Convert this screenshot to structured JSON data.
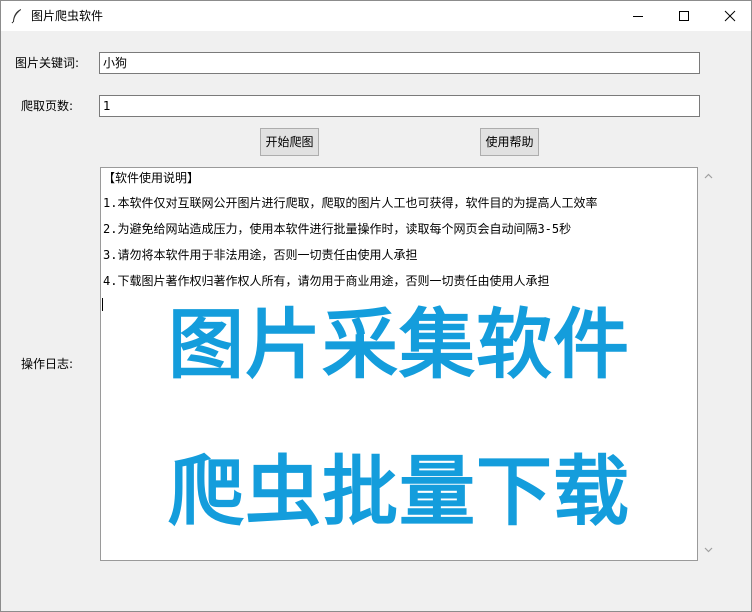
{
  "window": {
    "title": "图片爬虫软件"
  },
  "form": {
    "keyword_label": "图片关键词:",
    "keyword_value": "小狗",
    "pages_label": "爬取页数:",
    "pages_value": "1",
    "start_button": "开始爬图",
    "help_button": "使用帮助",
    "log_label": "操作日志:"
  },
  "log": {
    "lines": [
      "【软件使用说明】",
      "1.本软件仅对互联网公开图片进行爬取，爬取的图片人工也可获得，软件目的为提高人工效率",
      "2.为避免给网站造成压力，使用本软件进行批量操作时，读取每个网页会自动间隔3-5秒",
      "3.请勿将本软件用于非法用途，否则一切责任由使用人承担",
      "4.下载图片著作权归著作权人所有，请勿用于商业用途，否则一切责任由使用人承担"
    ],
    "banner_line1": "图片采集软件",
    "banner_line2": "爬虫批量下载"
  },
  "colors": {
    "banner": "#149ddc"
  }
}
